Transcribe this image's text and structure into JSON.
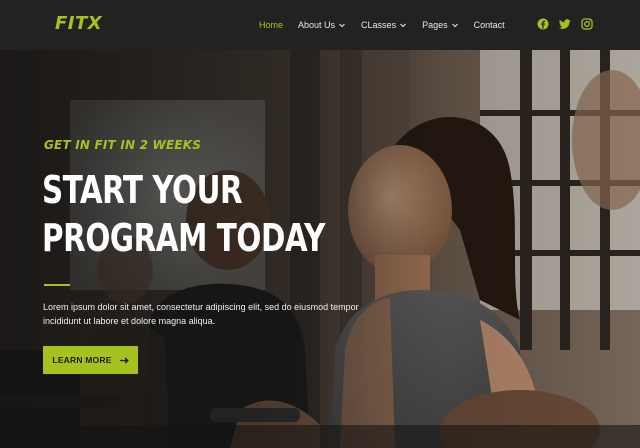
{
  "brand": {
    "logo": "FITX"
  },
  "nav": {
    "items": [
      {
        "label": "Home",
        "active": true,
        "dropdown": false
      },
      {
        "label": "About Us",
        "active": false,
        "dropdown": true
      },
      {
        "label": "CLasses",
        "active": false,
        "dropdown": true
      },
      {
        "label": "Pages",
        "active": false,
        "dropdown": true
      },
      {
        "label": "Contact",
        "active": false,
        "dropdown": false
      }
    ],
    "socials": [
      "facebook-icon",
      "twitter-icon",
      "instagram-icon"
    ]
  },
  "hero": {
    "tagline": "GET IN FIT IN 2 WEEKS",
    "title_line1": "START YOUR",
    "title_line2": "PROGRAM TODAY",
    "description": "Lorem ipsum dolor sit amet, consectetur adipiscing elit, sed do eiusmod tempor incididunt ut labore et dolore magna aliqua.",
    "button_label": "LEARN MORE",
    "button_icon": "arrow-right-icon"
  },
  "colors": {
    "accent": "#a6c21c",
    "navbar_bg": "#222222",
    "text": "#ffffff"
  }
}
